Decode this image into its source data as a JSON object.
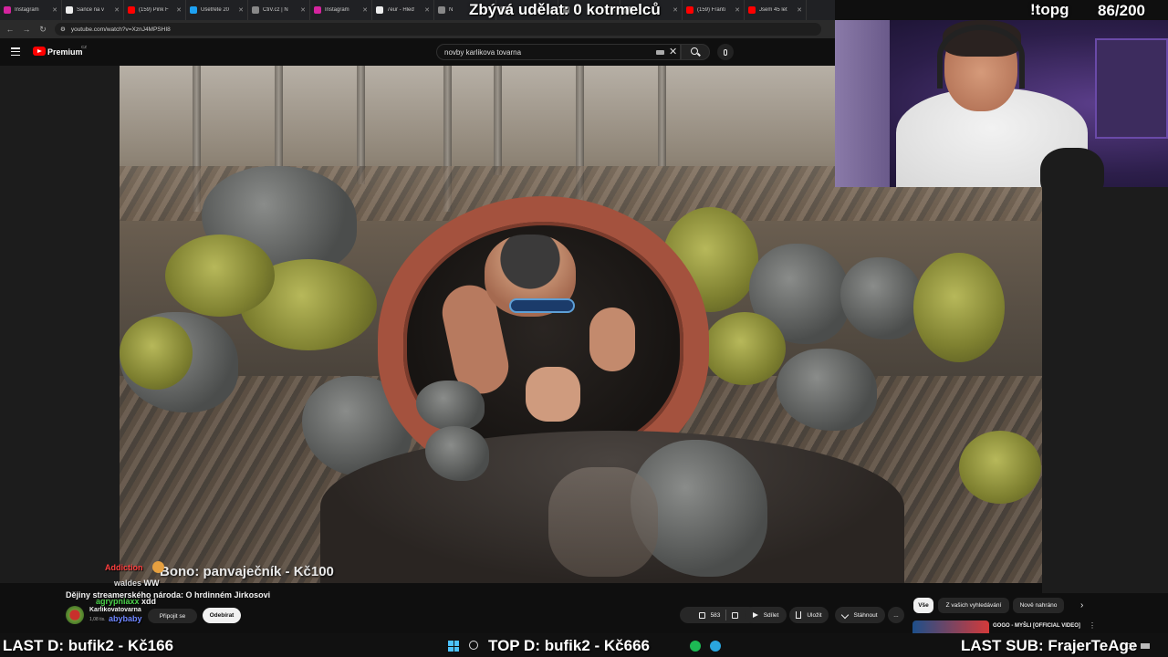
{
  "browser": {
    "tabs": [
      {
        "label": "Instagram",
        "color": "#d6249f"
      },
      {
        "label": "Šance na v",
        "color": "#eeeeee"
      },
      {
        "label": "(159) Pink F",
        "color": "#ff0000"
      },
      {
        "label": "Ušetřete 20",
        "color": "#1da1f2"
      },
      {
        "label": "ČtiV.cz | N",
        "color": "#888888"
      },
      {
        "label": "Instagram",
        "color": "#d6249f"
      },
      {
        "label": "7eur - Hleď",
        "color": "#eeeeee"
      },
      {
        "label": "N",
        "color": "#888888"
      },
      {
        "label": "",
        "color": "#888888"
      },
      {
        "label": "",
        "color": "#888888"
      },
      {
        "label": "",
        "color": "#888888"
      },
      {
        "label": "(159) Franti",
        "color": "#ff0000"
      },
      {
        "label": "Jsem 45 let",
        "color": "#ff0000"
      }
    ],
    "url": "youtube.com/watch?v=XznJ4MPSHI8"
  },
  "youtube": {
    "brand": "Premium",
    "country": "CZ",
    "search_query": "novby karlikova tovarna",
    "video_title": "Dějiny streamerského národa: O hrdinném Jirkosovi",
    "channel_name": "Karlikovatovarna",
    "channel_subs": "1,08 tis.",
    "join_label": "Připojit se",
    "subscribe_label": "Odebírat",
    "likes": "583",
    "share_label": "Sdílet",
    "save_label": "Uložit",
    "download_label": "Stáhnout",
    "more_label": "...",
    "chips": [
      "Vše",
      "Z vašich vyhledávání",
      "Nově nahráno"
    ],
    "related": {
      "title": "GOGO - MYŠLI [OFFICIAL VIDEO]",
      "more": "⋮"
    }
  },
  "video": {
    "donation_caption": "Bono: panvaječník - Kč100"
  },
  "overlay": {
    "goal_text": "Zbývá udělat: 0 kotrmelců",
    "command": "!topg",
    "counter": "86/200",
    "last_donation": "LAST D: bufik2 - Kč166",
    "top_donation": "TOP D: bufik2 - Kč666",
    "last_sub": "LAST SUB: FrajerTeAge"
  },
  "chat": [
    {
      "user": "Addiction",
      "message": ""
    },
    {
      "user": "waldes",
      "message": "WW"
    },
    {
      "user": "agrypniaxx",
      "message": "xdd"
    },
    {
      "user": "abybaby",
      "message": ""
    }
  ]
}
